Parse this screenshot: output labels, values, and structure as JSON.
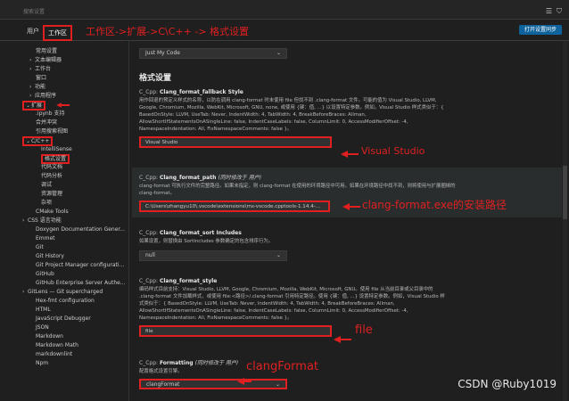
{
  "search": {
    "placeholder": "搜索设置"
  },
  "tabs": {
    "user": "用户",
    "workspace": "工作区"
  },
  "sync_button": "打开设置同步",
  "sidebar": {
    "items": [
      {
        "label": "常用设置",
        "chev": ""
      },
      {
        "label": "文本编辑器",
        "chev": "›"
      },
      {
        "label": "工作台",
        "chev": "›"
      },
      {
        "label": "窗口",
        "chev": ""
      },
      {
        "label": "功能",
        "chev": "›"
      },
      {
        "label": "应用程序",
        "chev": "›"
      },
      {
        "label": "扩展",
        "chev": "⌄"
      },
      {
        "label": ".ipynb 支持",
        "chev": ""
      },
      {
        "label": "合并冲突",
        "chev": ""
      },
      {
        "label": "引用搜索视图",
        "chev": ""
      },
      {
        "label": "C/C++",
        "chev": "⌄"
      },
      {
        "label": "IntelliSense",
        "chev": ""
      },
      {
        "label": "格式设置",
        "chev": ""
      },
      {
        "label": "代码文档",
        "chev": ""
      },
      {
        "label": "代码分析",
        "chev": ""
      },
      {
        "label": "调试",
        "chev": ""
      },
      {
        "label": "资源管理",
        "chev": ""
      },
      {
        "label": "杂项",
        "chev": ""
      },
      {
        "label": "CMake Tools",
        "chev": ""
      },
      {
        "label": "CSS 语言功能",
        "chev": "›"
      },
      {
        "label": "Doxygen Documentation Gener...",
        "chev": ""
      },
      {
        "label": "Emmet",
        "chev": ""
      },
      {
        "label": "Git",
        "chev": ""
      },
      {
        "label": "Git History",
        "chev": ""
      },
      {
        "label": "Git Project Manager configurati...",
        "chev": ""
      },
      {
        "label": "GitHub",
        "chev": ""
      },
      {
        "label": "GitHub Enterprise Server Authe...",
        "chev": ""
      },
      {
        "label": "GitLens — Git supercharged",
        "chev": "›"
      },
      {
        "label": "Hex-fmt configuration",
        "chev": ""
      },
      {
        "label": "HTML",
        "chev": ""
      },
      {
        "label": "JavaScript Debugger",
        "chev": ""
      },
      {
        "label": "JSON",
        "chev": ""
      },
      {
        "label": "Markdown",
        "chev": ""
      },
      {
        "label": "Markdown Math",
        "chev": ""
      },
      {
        "label": "markdownlint",
        "chev": ""
      },
      {
        "label": "Npm",
        "chev": ""
      }
    ]
  },
  "content": {
    "top_dropdown": "Just My Code",
    "heading": "格式设置",
    "fallback": {
      "prefix": "C_Cpp: ",
      "name": "Clang_format_fallback Style",
      "desc1": "用作回退的预定义样式的名称，以防在调用 clang-format 时未使用 file 但找不到 .clang-format 文件。可能的值为 Visual Studio, LLVM,",
      "desc2": "Google, Chromium, Mozilla, WebKit, Microsoft, GNU, none, 或使用 {键：值, ...} 以设置特定参数。例如，Visual Studio 样式类似于：{",
      "desc3": "BasedOnStyle: LLVM, UseTab: Never, IndentWidth: 4, TabWidth: 4, BreakBeforeBraces: Allman,",
      "desc4": "AllowShortIfStatementsOnASingleLine: false, IndentCaseLabels: false, ColumnLimit: 0, AccessModifierOffset: -4,",
      "desc5": "NamespaceIndentation: All, FixNamespaceComments: false }。",
      "value": "Visual Studio"
    },
    "path": {
      "prefix": "C_Cpp: ",
      "name": "Clang_format_path",
      "note": "(同时修改于 用户)",
      "desc1": "clang-format 可执行文件的完整路径。如果未指定，则 clang-format 在使用的环境路径中可用。如果在环境路径中找不到，则将使用与扩展捆绑的",
      "desc2": "clang-format。",
      "value": "C:\\Users\\zhangyu10\\.vscode\\extensions\\ms-vscode.cpptools-1.14.4-..."
    },
    "sort": {
      "prefix": "C_Cpp: ",
      "name": "Clang_format_sort Includes",
      "desc1": "如果设置，则替换由 SortIncludes 参数确定的包含排序行为。",
      "value": "null"
    },
    "style": {
      "prefix": "C_Cpp: ",
      "name": "Clang_format_style",
      "desc1": "编码样式目前支持：Visual Studio, LLVM, Google, Chromium, Mozilla, WebKit, Microsoft, GNU。使用 file 从当前目录或父目录中的",
      "desc2": ".clang-format 文件加载样式，或使用 file:<路径>/.clang-format 引用特定路径。使用 {键：值, ...} 设置特定参数。例如，Visual Studio 样",
      "desc3": "式类似于：{ BasedOnStyle: LLVM, UseTab: Never, IndentWidth: 4, TabWidth: 4, BreakBeforeBraces: Allman,",
      "desc4": "AllowShortIfStatementsOnASingleLine: false, IndentCaseLabels: false, ColumnLimit: 0, AccessModifierOffset: -4,",
      "desc5": "NamespaceIndentation: All, FixNamespaceComments: false }。",
      "value": "file"
    },
    "formatting": {
      "prefix": "C_Cpp: ",
      "name": "Formatting",
      "note": "(同时修改于 用户)",
      "desc1": "配置格式设置引擎。",
      "value": "clangFormat"
    }
  },
  "annotations": {
    "header": "工作区->扩展->C\\C++ -> 格式设置",
    "vs": "Visual Studio",
    "path": "clang-format.exe的安装路径",
    "file": "file",
    "clang": "clangFormat"
  },
  "watermark": "CSDN @Ruby1019",
  "colors": {
    "annotation_red": "#e02020",
    "button_blue": "#0e639c",
    "background": "#1f1f1f"
  }
}
